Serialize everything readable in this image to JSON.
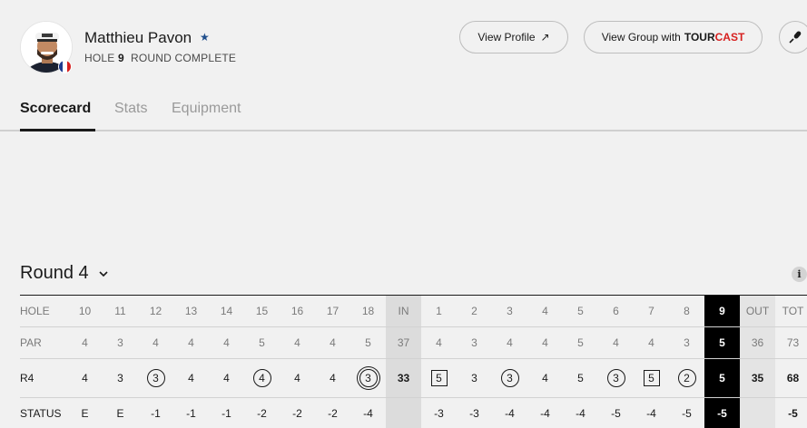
{
  "player": {
    "name": "Matthieu Pavon",
    "hole_label": "HOLE",
    "hole_number": "9",
    "round_status": "ROUND COMPLETE",
    "flag_colors": [
      "#1f3c8f",
      "#ffffff",
      "#d7201f"
    ]
  },
  "buttons": {
    "view_profile": "View Profile",
    "view_group_prefix": "View Group with",
    "tourcast_tour": "TOUR",
    "tourcast_cast": "CAST"
  },
  "tabs": [
    {
      "label": "Scorecard",
      "active": true
    },
    {
      "label": "Stats",
      "active": false
    },
    {
      "label": "Equipment",
      "active": false
    }
  ],
  "round": {
    "title": "Round 4"
  },
  "colors": {
    "accent": "#d7201f",
    "current_hole_bg": "#000000",
    "shaded_total_bg": "#dcdcdc"
  },
  "scorecard": {
    "row_labels": {
      "hole": "HOLE",
      "par": "PAR",
      "round": "R4",
      "status": "STATUS"
    },
    "columns": [
      {
        "hole": "10",
        "par": "4",
        "score": "4",
        "mark": "none",
        "status": "E"
      },
      {
        "hole": "11",
        "par": "3",
        "score": "3",
        "mark": "none",
        "status": "E"
      },
      {
        "hole": "12",
        "par": "4",
        "score": "3",
        "mark": "circle",
        "status": "-1"
      },
      {
        "hole": "13",
        "par": "4",
        "score": "4",
        "mark": "none",
        "status": "-1"
      },
      {
        "hole": "14",
        "par": "4",
        "score": "4",
        "mark": "none",
        "status": "-1"
      },
      {
        "hole": "15",
        "par": "5",
        "score": "4",
        "mark": "circle",
        "status": "-2"
      },
      {
        "hole": "16",
        "par": "4",
        "score": "4",
        "mark": "none",
        "status": "-2"
      },
      {
        "hole": "17",
        "par": "4",
        "score": "4",
        "mark": "none",
        "status": "-2"
      },
      {
        "hole": "18",
        "par": "5",
        "score": "3",
        "mark": "double",
        "status": "-4"
      },
      {
        "hole": "IN",
        "par": "37",
        "score": "33",
        "mark": "none",
        "status": "",
        "kind": "in"
      },
      {
        "hole": "1",
        "par": "4",
        "score": "5",
        "mark": "square",
        "status": "-3"
      },
      {
        "hole": "2",
        "par": "3",
        "score": "3",
        "mark": "none",
        "status": "-3"
      },
      {
        "hole": "3",
        "par": "4",
        "score": "3",
        "mark": "circle",
        "status": "-4"
      },
      {
        "hole": "4",
        "par": "4",
        "score": "4",
        "mark": "none",
        "status": "-4"
      },
      {
        "hole": "5",
        "par": "5",
        "score": "5",
        "mark": "none",
        "status": "-4"
      },
      {
        "hole": "6",
        "par": "4",
        "score": "3",
        "mark": "circle",
        "status": "-5"
      },
      {
        "hole": "7",
        "par": "4",
        "score": "5",
        "mark": "square",
        "status": "-4"
      },
      {
        "hole": "8",
        "par": "3",
        "score": "2",
        "mark": "circle",
        "status": "-5"
      },
      {
        "hole": "9",
        "par": "5",
        "score": "5",
        "mark": "none",
        "status": "-5",
        "kind": "current"
      },
      {
        "hole": "OUT",
        "par": "36",
        "score": "35",
        "mark": "none",
        "status": "",
        "kind": "out"
      },
      {
        "hole": "TOT",
        "par": "73",
        "score": "68",
        "mark": "none",
        "status": "-5",
        "kind": "tot"
      }
    ]
  }
}
